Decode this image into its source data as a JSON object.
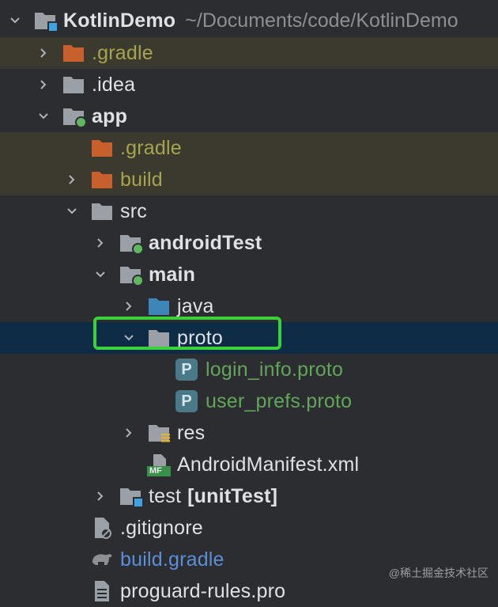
{
  "project": {
    "name": "KotlinDemo",
    "path": "~/Documents/code/KotlinDemo"
  },
  "tree": [
    {
      "label": ".gradle",
      "icon": "folder-orange-icon",
      "chevron": "right"
    },
    {
      "label": ".idea",
      "icon": "folder-gray-icon",
      "chevron": "right"
    },
    {
      "label": "app",
      "icon": "module-folder-icon",
      "chevron": "down"
    },
    {
      "label": ".gradle",
      "icon": "folder-orange-icon",
      "chevron": "none"
    },
    {
      "label": "build",
      "icon": "folder-orange-icon",
      "chevron": "right"
    },
    {
      "label": "src",
      "icon": "folder-gray-icon",
      "chevron": "down"
    },
    {
      "label": "androidTest",
      "icon": "source-folder-green-dot-icon",
      "chevron": "right"
    },
    {
      "label": "main",
      "icon": "source-folder-green-dot-icon",
      "chevron": "down"
    },
    {
      "label": "java",
      "icon": "folder-blue-icon",
      "chevron": "right"
    },
    {
      "label": "proto",
      "icon": "folder-gray-icon",
      "chevron": "down",
      "selected": true
    },
    {
      "label": "login_info.proto",
      "icon": "proto-file-icon",
      "chevron": "none"
    },
    {
      "label": "user_prefs.proto",
      "icon": "proto-file-icon",
      "chevron": "none"
    },
    {
      "label": "res",
      "icon": "resources-folder-icon",
      "chevron": "right"
    },
    {
      "label": "AndroidManifest.xml",
      "icon": "manifest-file-icon",
      "chevron": "none"
    },
    {
      "label": "test",
      "suffix": "[unitTest]",
      "icon": "test-folder-icon",
      "chevron": "right"
    },
    {
      "label": ".gitignore",
      "icon": "ignored-file-icon",
      "chevron": "none"
    },
    {
      "label": "build.gradle",
      "icon": "gradle-elephant-icon",
      "chevron": "none"
    },
    {
      "label": "proguard-rules.pro",
      "icon": "text-file-icon",
      "chevron": "none"
    }
  ],
  "proto_badge": "P",
  "manifest_badge": "MF",
  "watermark": "@稀土掘金技术社区",
  "colors": {
    "background": "#2b2d30",
    "selected_row": "#0e2c46",
    "excluded_row": "#3c3a2f",
    "highlight_border": "#3ad13a",
    "excluded_text": "#a5a54b",
    "proto_text": "#62a65a",
    "gradle_text": "#5a8fd8"
  }
}
